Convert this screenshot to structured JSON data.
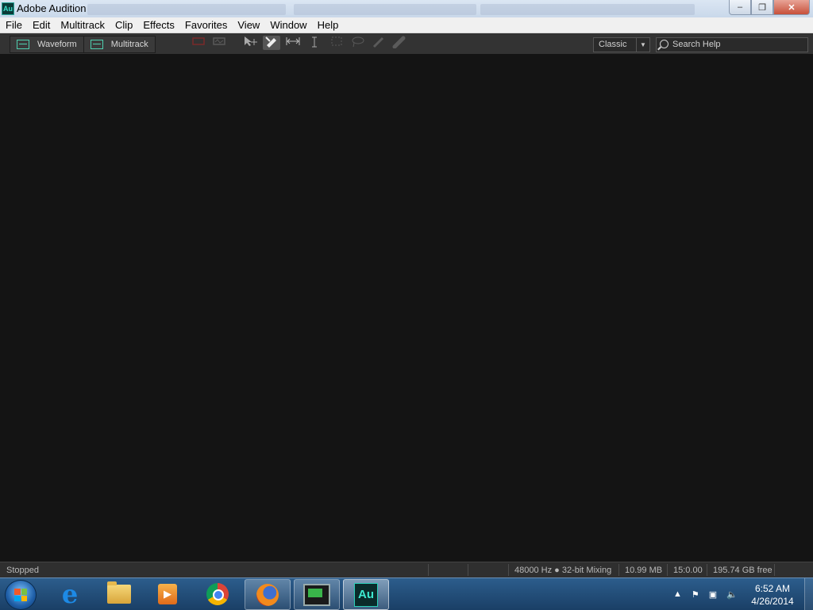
{
  "window": {
    "title": "Adobe Audition",
    "app_icon_text": "Au"
  },
  "window_controls": {
    "minimize": "–",
    "restore": "❐",
    "close": "✕"
  },
  "menubar": [
    "File",
    "Edit",
    "Multitrack",
    "Clip",
    "Effects",
    "Favorites",
    "View",
    "Window",
    "Help"
  ],
  "toolbar": {
    "waveform_label": "Waveform",
    "multitrack_label": "Multitrack",
    "tools": [
      "move-tool-icon",
      "razor-tool-icon",
      "time-selection-tool-icon",
      "text-cursor-tool-icon",
      "marquee-selection-tool-icon",
      "lasso-selection-tool-icon",
      "paintbrush-selection-tool-icon",
      "spot-healing-brush-tool-icon"
    ],
    "workspace": {
      "selected": "Classic"
    },
    "search": {
      "placeholder": "Search Help"
    }
  },
  "statusbar": {
    "state": "Stopped",
    "format": "48000 Hz ● 32-bit Mixing",
    "memory": "10.99 MB",
    "duration": "15:0.00",
    "disk": "195.74 GB free"
  },
  "taskbar": {
    "apps": [
      "start-button",
      "internet-explorer",
      "file-explorer",
      "media-player",
      "chrome",
      "firefox",
      "system-monitor",
      "adobe-audition"
    ],
    "au_label": "Au",
    "clock": {
      "time": "6:52 AM",
      "date": "4/26/2014"
    }
  },
  "colors": {
    "main_bg": "#141414",
    "toolbar_bg": "#333333",
    "accent": "#4fd0b0"
  }
}
